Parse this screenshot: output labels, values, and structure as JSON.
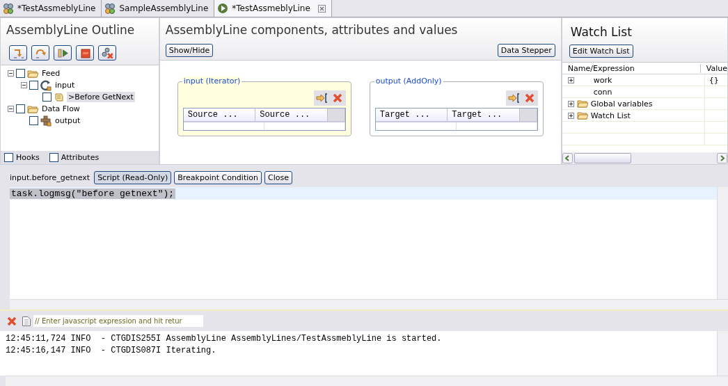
{
  "editor_tabs": [
    {
      "label": "*TestAssmeblyLine",
      "selected": false,
      "kind": "assembly"
    },
    {
      "label": "SampleAssemblyLine",
      "selected": false,
      "kind": "assembly"
    },
    {
      "label": "*TestAssmeblyLine",
      "selected": true,
      "kind": "running"
    }
  ],
  "outline": {
    "title": "AssemblyLine Outline",
    "toolbar": [
      {
        "kind": "step"
      },
      {
        "kind": "curve"
      },
      {
        "kind": "play"
      },
      {
        "kind": "stop"
      },
      {
        "kind": "remove"
      }
    ],
    "tree": [
      {
        "label": "Feed",
        "kind": "folder",
        "checked": false,
        "selected": false,
        "expanded": true,
        "children": [
          {
            "label": "input",
            "kind": "iterator",
            "checked": false,
            "selected": false,
            "expanded": true,
            "children": [
              {
                "label": ">Before GetNext",
                "kind": "hook",
                "checked": false,
                "selected": true
              }
            ]
          }
        ]
      },
      {
        "label": "Data Flow",
        "kind": "folder",
        "checked": false,
        "selected": false,
        "expanded": true,
        "children": [
          {
            "label": "output",
            "kind": "connector",
            "checked": false,
            "selected": false
          }
        ]
      }
    ],
    "options": [
      {
        "label": "Hooks",
        "checked": false
      },
      {
        "label": "Attributes",
        "checked": false
      }
    ]
  },
  "components": {
    "title": "AssemblyLine components, attributes and values",
    "left_button": "Show/Hide",
    "right_button": "Data Stepper",
    "connectors": [
      {
        "title": "input (Iterator)",
        "highlighted": true,
        "columns": [
          "Source ...",
          "Source ..."
        ]
      },
      {
        "title": "output (AddOnly)",
        "highlighted": false,
        "columns": [
          "Target ...",
          "Target ..."
        ]
      }
    ]
  },
  "watch_list": {
    "title": "Watch List",
    "button": "Edit Watch List",
    "columns": [
      "Name/Expression",
      "Value"
    ],
    "rows": [
      {
        "name": "work",
        "value": "{}",
        "expandable": true,
        "folder": false
      },
      {
        "name": "conn",
        "expandable": false,
        "folder": false
      },
      {
        "name": "Global variables",
        "expandable": true,
        "folder": true
      },
      {
        "name": "Watch List",
        "expandable": true,
        "folder": true
      }
    ]
  },
  "script": {
    "label": "input.before_getnext",
    "buttons": [
      {
        "label": "Script (Read-Only)",
        "selected": true
      },
      {
        "label": "Breakpoint Condition",
        "selected": false
      },
      {
        "label": "Close",
        "selected": false
      }
    ],
    "lines": [
      {
        "text": "task.logmsg(\"before getnext\");",
        "current": true
      }
    ]
  },
  "console": {
    "placeholder": "// Enter javascript expression and hit retur",
    "log": [
      "12:45:11,724 INFO  - CTGDIS255I AssemblyLine AssemblyLines/TestAssmeblyLine is started.",
      "12:45:16,147 INFO  - CTGDIS087I Iterating."
    ]
  }
}
